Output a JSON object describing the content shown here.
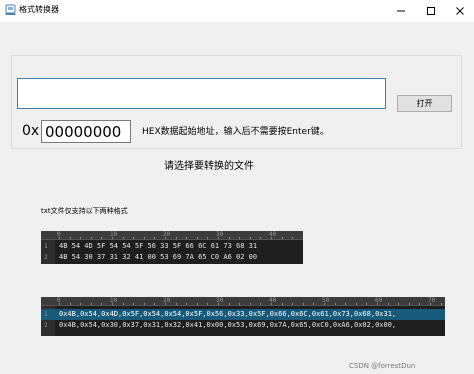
{
  "window": {
    "title": "格式转换器",
    "controls": {
      "minimize_icon": "minimize-icon",
      "maximize_icon": "maximize-icon",
      "close_icon": "close-icon"
    }
  },
  "file_input": {
    "value": "",
    "placeholder": ""
  },
  "open_button": {
    "label": "打开"
  },
  "hex_address": {
    "prefix": "0x",
    "value": "00000000",
    "hint": "HEX数据起始地址，输入后不需要按Enter键。"
  },
  "select_prompt": "请选择要转换的文件",
  "format_note": "txt文件仅支持以下两种格式",
  "sample_space": {
    "ruler": [
      "0",
      "10",
      "20",
      "30",
      "40",
      "50",
      "60",
      "70",
      "80"
    ],
    "lines": [
      {
        "no": "1",
        "text": "4B 54 4D 5F 54 54 5F 56 33 5F 66 6C 61 73 68 31"
      },
      {
        "no": "2",
        "text": "4B 54 30 37 31 32 41 00 53 69 7A 65 C0 A6 02 00"
      }
    ]
  },
  "sample_comma": {
    "ruler": [
      "0",
      "10",
      "20",
      "30",
      "40",
      "50",
      "60",
      "70",
      "80"
    ],
    "lines": [
      {
        "no": "1",
        "text": "0x4B,0x54,0x4D,0x5F,0x54,0x54,0x5F,0x56,0x33,0x5F,0x66,0x6C,0x61,0x73,0x68,0x31,"
      },
      {
        "no": "2",
        "text": "0x4B,0x54,0x30,0x37,0x31,0x32,0x41,0x00,0x53,0x69,0x7A,0x65,0xC0,0xA6,0x02,0x00,"
      }
    ]
  },
  "watermark": "CSDN @forrestDun",
  "colors": {
    "window_bg": "#f0f0f0",
    "input_focus_border": "#3c7fb1",
    "editor_bg": "#1e1e1e",
    "selection": "#175a7a"
  }
}
